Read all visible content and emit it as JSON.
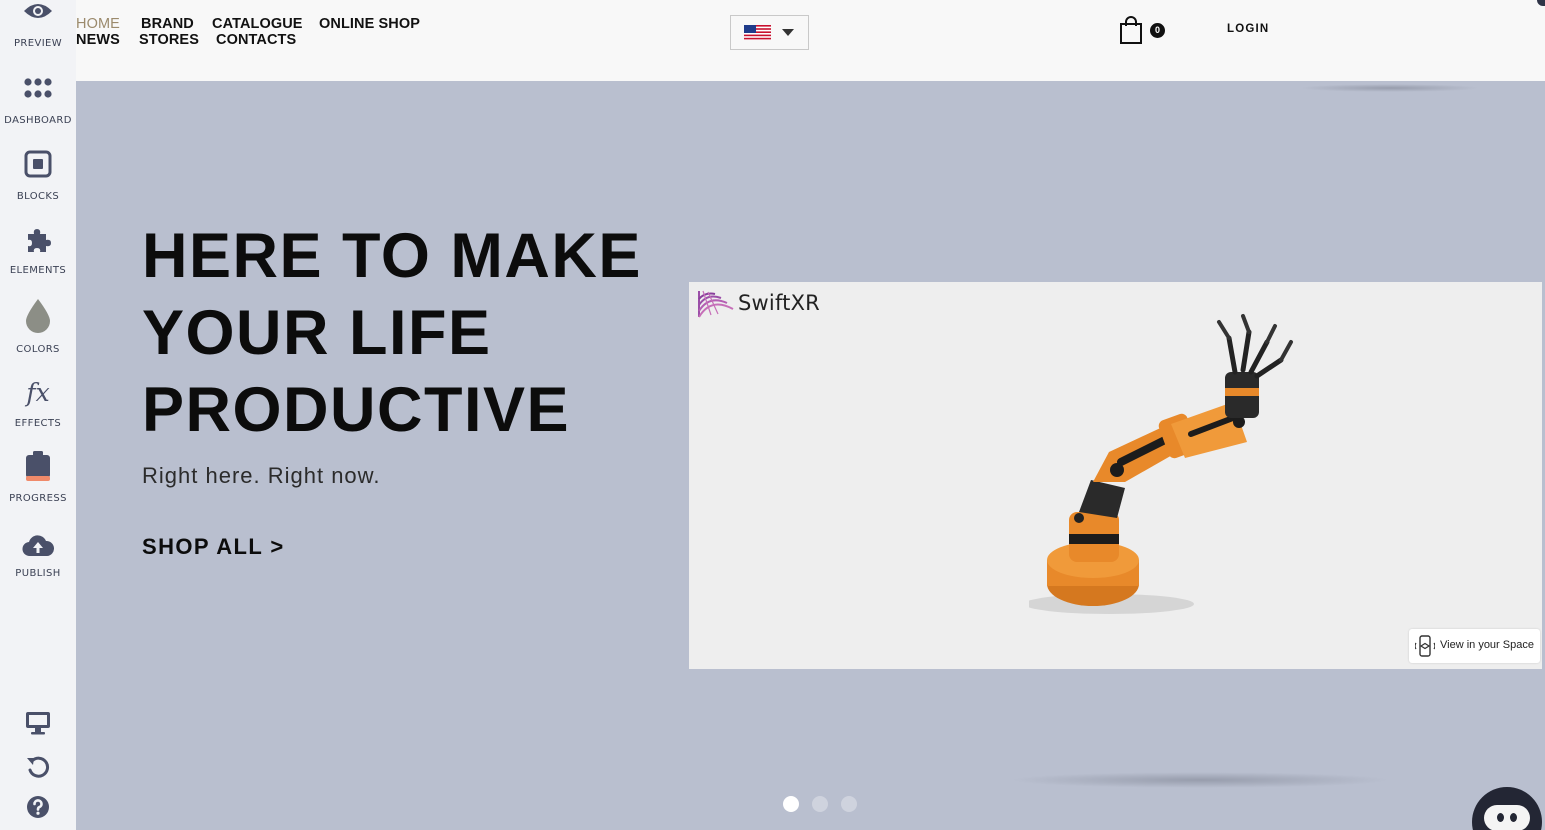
{
  "sidebar": {
    "items": [
      {
        "label": "PREVIEW",
        "icon": "eye-icon"
      },
      {
        "label": "DASHBOARD",
        "icon": "dots-grid-icon"
      },
      {
        "label": "BLOCKS",
        "icon": "block-square-icon"
      },
      {
        "label": "ELEMENTS",
        "icon": "puzzle-icon"
      },
      {
        "label": "COLORS",
        "icon": "droplet-icon"
      },
      {
        "label": "EFFECTS",
        "icon": "fx-icon"
      },
      {
        "label": "PROGRESS",
        "icon": "clipboard-progress-icon"
      },
      {
        "label": "PUBLISH",
        "icon": "cloud-upload-icon"
      }
    ],
    "bottom_icons": [
      "desktop-icon",
      "undo-icon",
      "help-icon"
    ],
    "effects_glyph": "fx",
    "icon_color": "#4a5069",
    "progress_accent": "#f08a6a"
  },
  "header": {
    "nav": {
      "home": "HOME",
      "news": "NEWS",
      "brand": "BRAND",
      "stores": "STORES",
      "catalogue": "CATALOGUE",
      "contacts": "CONTACTS",
      "online_shop": "ONLINE SHOP"
    },
    "active_color": "#9b8a6c",
    "language_icon": "us-flag-icon",
    "cart_count": "0",
    "login": "LOGIN"
  },
  "hero": {
    "title_lines": [
      "HERE TO MAKE",
      "YOUR LIFE",
      "PRODUCTIVE"
    ],
    "subtitle": "Right here. Right now.",
    "cta": "SHOP ALL >",
    "background": "#b9bfcf"
  },
  "viewer": {
    "brand": "SwiftXR",
    "ar_button": "View in your Space",
    "model": "orange-robotic-arm"
  },
  "carousel": {
    "slides": 3,
    "active_index": 0
  },
  "chat_widget": {
    "icon": "chat-bot-icon"
  }
}
